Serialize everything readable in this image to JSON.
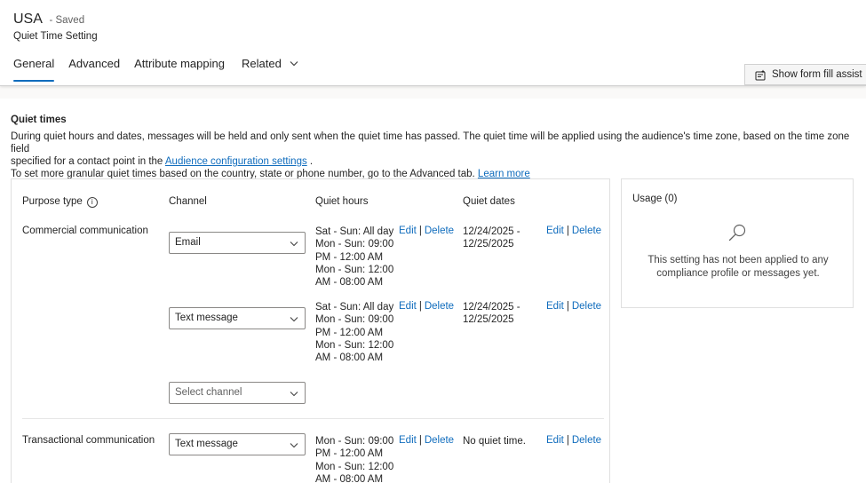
{
  "record": {
    "title": "USA",
    "status": "- Saved",
    "subtitle": "Quiet Time Setting"
  },
  "tabs": [
    {
      "label": "General"
    },
    {
      "label": "Advanced"
    },
    {
      "label": "Attribute mapping"
    },
    {
      "label": "Related"
    }
  ],
  "toolbar": {
    "assist_label": "Show form fill assist"
  },
  "section": {
    "title": "Quiet times",
    "desc_line1": "During quiet hours and dates, messages will be held and only sent when the quiet time has passed. The quiet time will be applied using the audience's time zone, based on the time zone field",
    "desc_line2_pre": "specified for a contact point in the ",
    "desc_line2_link": "Audience configuration settings",
    "desc_line2_post": " .",
    "desc_line3_pre": "To set more granular quiet times based on the country, state or phone number, go to the Advanced tab. ",
    "desc_line3_link": "Learn more"
  },
  "table": {
    "headers": {
      "purpose": "Purpose type",
      "channel": "Channel",
      "hours": "Quiet hours",
      "dates": "Quiet dates"
    },
    "edit_label": "Edit",
    "separator": "|",
    "delete_label": "Delete",
    "rows": [
      {
        "purpose": "Commercial communication",
        "channel": "Email",
        "hours": "Sat - Sun: All day Mon - Sun: 09:00 PM - 12:00 AM Mon - Sun: 12:00 AM - 08:00 AM",
        "dates": "12/24/2025 - 12/25/2025"
      },
      {
        "purpose": "",
        "channel": "Text message",
        "hours": "Sat - Sun: All day Mon - Sun: 09:00 PM - 12:00 AM Mon - Sun: 12:00 AM - 08:00 AM",
        "dates": "12/24/2025 - 12/25/2025"
      },
      {
        "purpose": "",
        "channel_placeholder": "Select channel"
      },
      {
        "purpose": "Transactional communication",
        "channel": "Text message",
        "hours": "Mon - Sun: 09:00 PM - 12:00 AM Mon - Sun: 12:00 AM - 08:00 AM",
        "dates": "No quiet time."
      }
    ]
  },
  "usage": {
    "title": "Usage (0)",
    "icon": "search-icon",
    "message": "This setting has not been applied to any compliance profile or messages yet."
  },
  "colors": {
    "accent": "#0f6cbd",
    "text": "#242424",
    "border": "#e0e0e0"
  }
}
